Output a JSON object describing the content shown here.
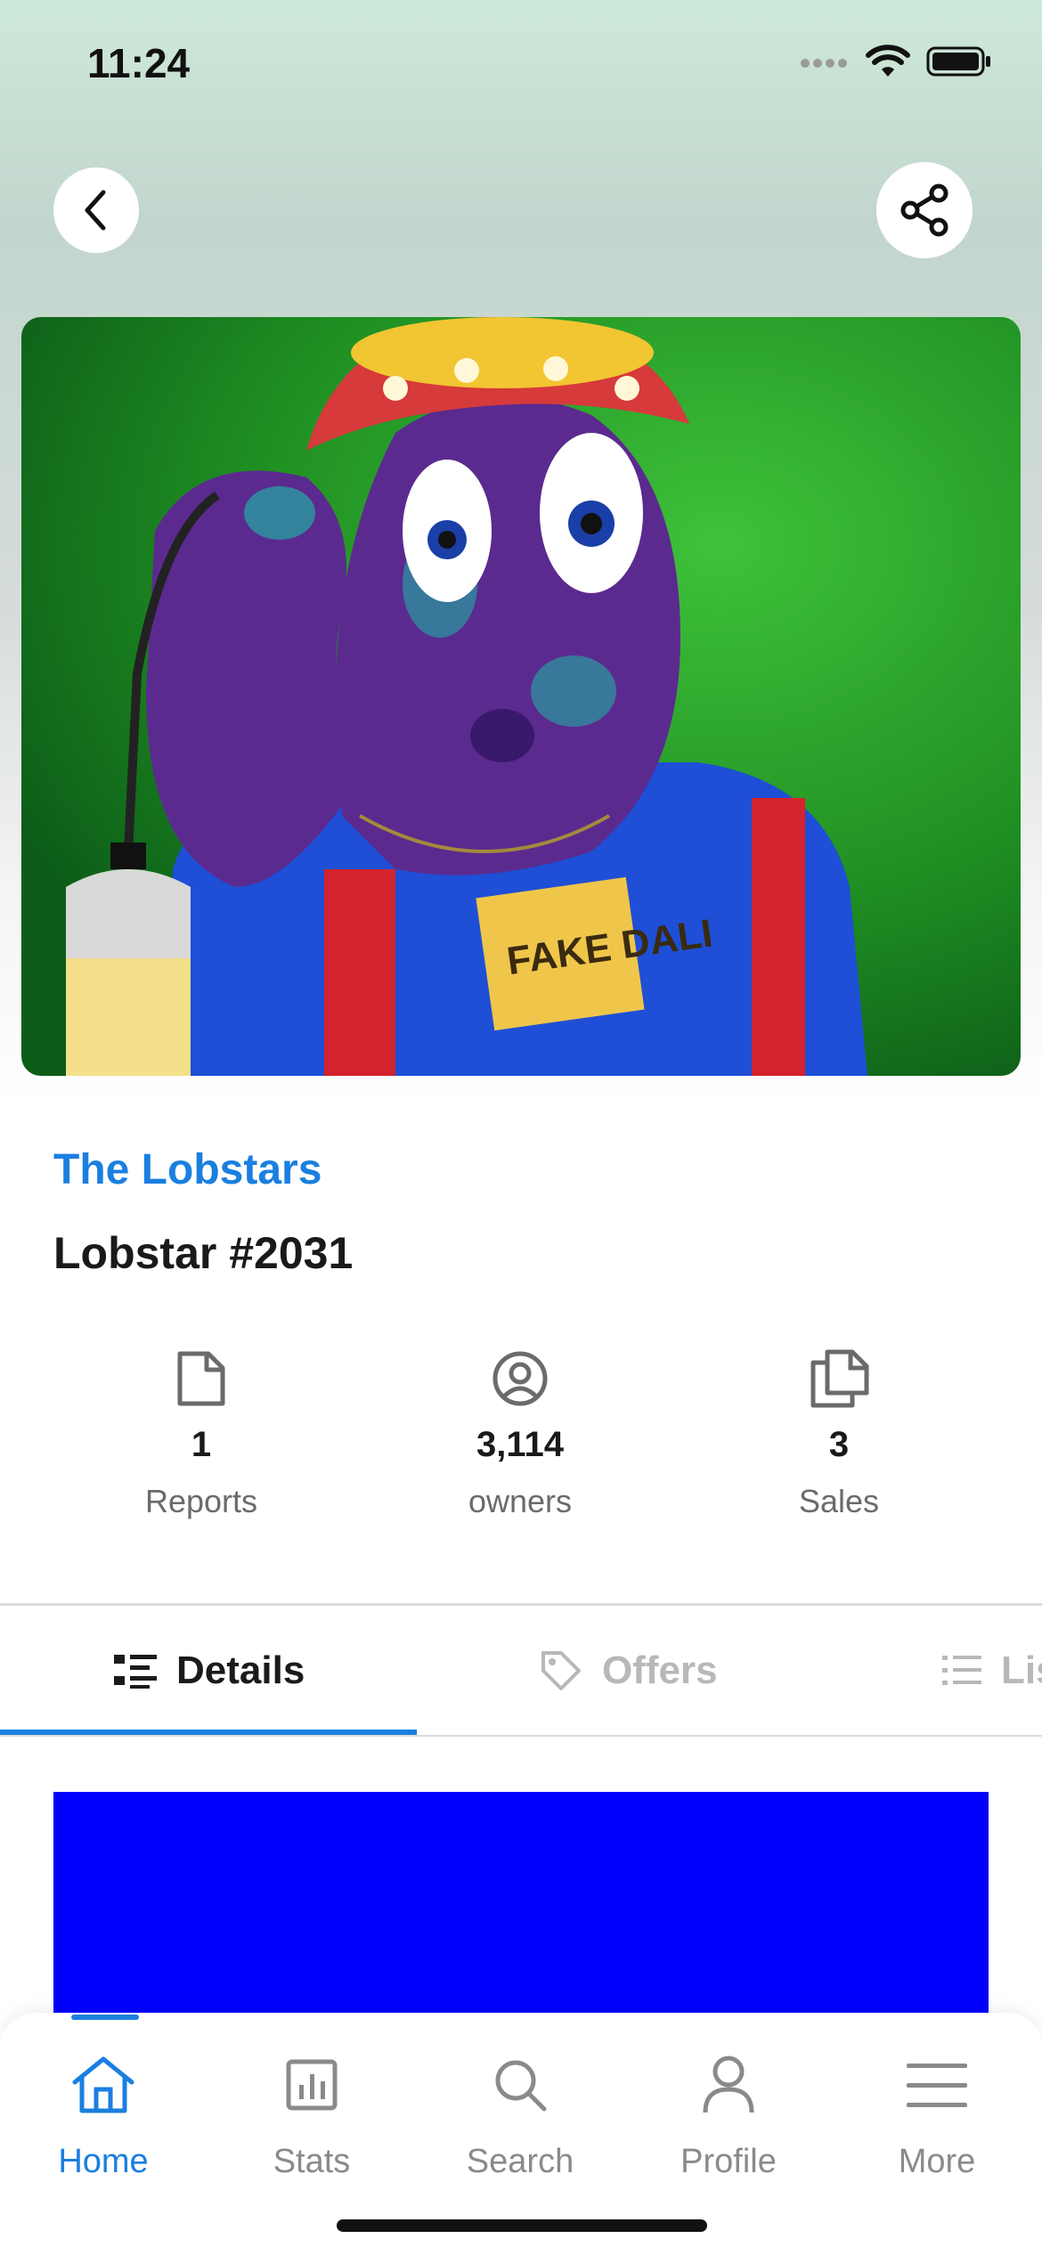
{
  "status_bar": {
    "time": "11:24"
  },
  "header": {
    "back_icon": "chevron-left-icon",
    "share_icon": "share-icon"
  },
  "nft": {
    "image_description_icon": "nft-artwork",
    "collection": "The Lobstars",
    "name": "Lobstar #2031",
    "image_lettering": "FAKE DALI"
  },
  "stats": [
    {
      "icon": "document-icon",
      "value": "1",
      "label": "Reports"
    },
    {
      "icon": "user-circle-icon",
      "value": "3,114",
      "label": "owners"
    },
    {
      "icon": "copies-icon",
      "value": "3",
      "label": "Sales"
    }
  ],
  "tabs": [
    {
      "icon": "details-list-icon",
      "label": "Details",
      "active": true
    },
    {
      "icon": "tag-icon",
      "label": "Offers",
      "active": false
    },
    {
      "icon": "list-icon",
      "label": "Lis",
      "active": false
    }
  ],
  "bottom_nav": [
    {
      "icon": "home-icon",
      "label": "Home",
      "active": true
    },
    {
      "icon": "stats-icon",
      "label": "Stats",
      "active": false
    },
    {
      "icon": "search-icon",
      "label": "Search",
      "active": false
    },
    {
      "icon": "profile-icon",
      "label": "Profile",
      "active": false
    },
    {
      "icon": "menu-icon",
      "label": "More",
      "active": false
    }
  ],
  "colors": {
    "accent": "#1a7fe0",
    "content_block": "#0000ff",
    "nft_background": "#2a9d2a"
  }
}
